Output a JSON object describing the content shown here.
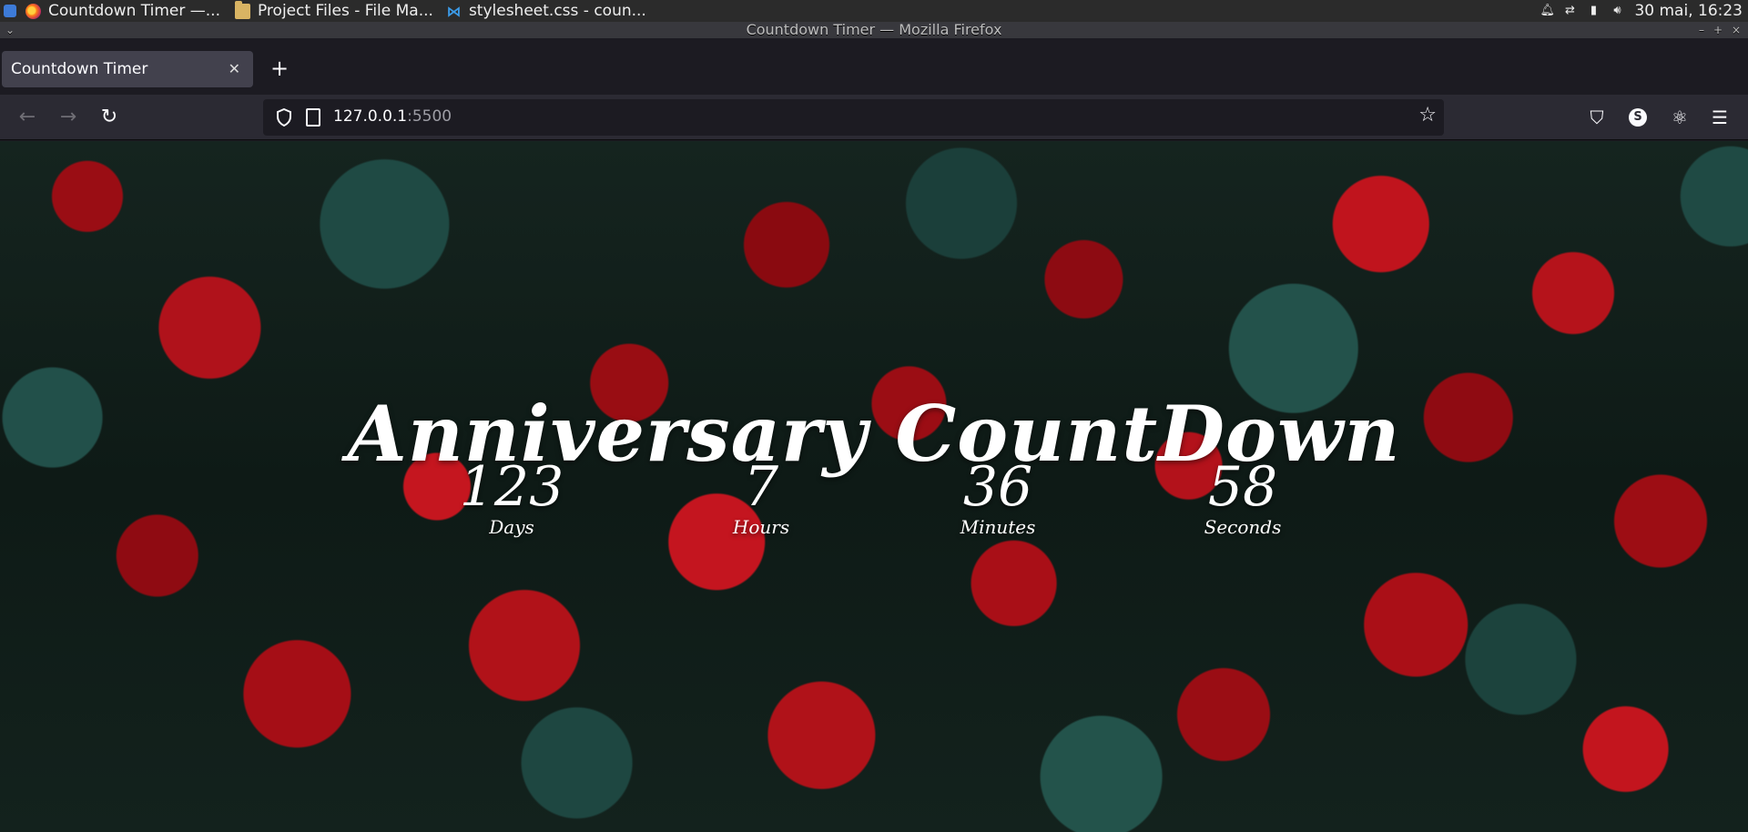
{
  "taskbar": {
    "tasks": [
      {
        "label": "Countdown Timer —...",
        "icon": "firefox-icon"
      },
      {
        "label": "Project Files - File Ma...",
        "icon": "folder-icon"
      },
      {
        "label": "stylesheet.css - coun...",
        "icon": "vscode-icon"
      }
    ],
    "clock": "30 mai, 16:23"
  },
  "window": {
    "title": "Countdown Timer — Mozilla Firefox"
  },
  "browser": {
    "tab_title": "Countdown Timer",
    "url_host": "127.0.0.1",
    "url_port": ":5500",
    "profile_initial": "S"
  },
  "page": {
    "title": "Anniversary CountDown",
    "countdown": [
      {
        "value": "123",
        "label": "Days"
      },
      {
        "value": "7",
        "label": "Hours"
      },
      {
        "value": "36",
        "label": "Minutes"
      },
      {
        "value": "58",
        "label": "Seconds"
      }
    ]
  },
  "colors": {
    "accent_text": "#ffffff",
    "rose": "#b0121b",
    "leaf": "#1f4a44"
  }
}
